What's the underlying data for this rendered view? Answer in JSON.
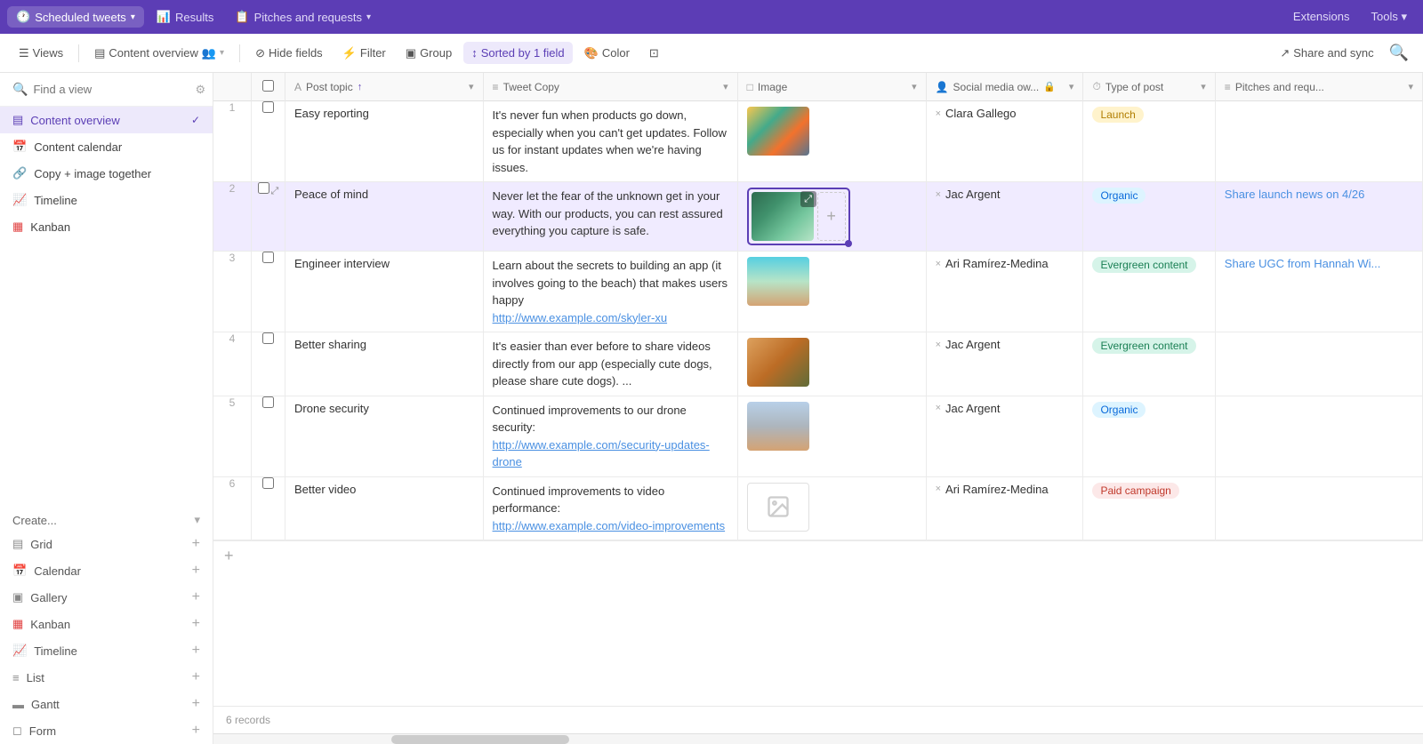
{
  "topbar": {
    "tabs": [
      {
        "id": "scheduled",
        "icon": "🕐",
        "label": "Scheduled tweets",
        "active": true,
        "hasChevron": true
      },
      {
        "id": "results",
        "icon": "📊",
        "label": "Results",
        "active": false,
        "hasChevron": false
      },
      {
        "id": "pitches",
        "icon": "📋",
        "label": "Pitches and requests",
        "active": false,
        "hasChevron": false
      }
    ],
    "right": [
      {
        "id": "extensions",
        "label": "Extensions"
      },
      {
        "id": "tools",
        "label": "Tools ▾"
      }
    ]
  },
  "toolbar": {
    "views_label": "Views",
    "content_overview_label": "Content overview",
    "hide_fields_label": "Hide fields",
    "filter_label": "Filter",
    "group_label": "Group",
    "sort_label": "Sorted by 1 field",
    "color_label": "Color",
    "extra_label": "",
    "share_label": "Share and sync"
  },
  "sidebar": {
    "search_placeholder": "Find a view",
    "nav_items": [
      {
        "id": "content-overview",
        "icon": "▤",
        "label": "Content overview",
        "active": true
      },
      {
        "id": "content-calendar",
        "icon": "📅",
        "label": "Content calendar",
        "active": false
      },
      {
        "id": "copy-image",
        "icon": "🔗",
        "label": "Copy + image together",
        "active": false
      },
      {
        "id": "timeline",
        "icon": "📈",
        "label": "Timeline",
        "active": false
      },
      {
        "id": "kanban",
        "icon": "▦",
        "label": "Kanban",
        "active": false
      }
    ],
    "create_label": "Create...",
    "create_items": [
      {
        "id": "grid",
        "icon": "▤",
        "label": "Grid"
      },
      {
        "id": "calendar",
        "icon": "📅",
        "label": "Calendar"
      },
      {
        "id": "gallery",
        "icon": "▣",
        "label": "Gallery"
      },
      {
        "id": "kanban2",
        "icon": "▦",
        "label": "Kanban"
      },
      {
        "id": "timeline2",
        "icon": "📈",
        "label": "Timeline"
      },
      {
        "id": "list",
        "icon": "≡",
        "label": "List"
      },
      {
        "id": "gantt",
        "icon": "▬",
        "label": "Gantt"
      },
      {
        "id": "form",
        "icon": "◻",
        "label": "Form"
      }
    ]
  },
  "table": {
    "columns": [
      {
        "id": "num",
        "label": ""
      },
      {
        "id": "checkbox",
        "label": ""
      },
      {
        "id": "topic",
        "label": "Post topic",
        "icon": "A"
      },
      {
        "id": "tweet",
        "label": "Tweet Copy",
        "icon": "≡"
      },
      {
        "id": "image",
        "label": "Image",
        "icon": "□"
      },
      {
        "id": "owner",
        "label": "Social media ow...",
        "icon": "👤"
      },
      {
        "id": "type",
        "label": "Type of post",
        "icon": "⏱"
      },
      {
        "id": "pitches",
        "label": "Pitches and requ...",
        "icon": "≡"
      }
    ],
    "rows": [
      {
        "num": "1",
        "topic": "Easy reporting",
        "tweet": "It's never fun when products go down, especially when you can't get updates. Follow us for instant updates when we're having issues.",
        "tweet_link": null,
        "image_type": "colorful",
        "owner": "Clara Gallego",
        "type": "Launch",
        "type_color": "launch",
        "pitches": ""
      },
      {
        "num": "2",
        "topic": "Peace of mind",
        "tweet": "Never let the fear of the unknown get in your way. With our products, you can rest assured everything you capture is safe.",
        "tweet_link": null,
        "image_type": "green",
        "image_active": true,
        "owner": "Jac Argent",
        "type": "Organic",
        "type_color": "organic",
        "pitches": "Share launch news on 4/26"
      },
      {
        "num": "3",
        "topic": "Engineer interview",
        "tweet": "Learn about the secrets to building an app (it involves going to the beach) that makes users happy",
        "tweet_link": "http://www.example.com/skyler-xu",
        "image_type": "beach",
        "owner": "Ari Ramírez-Medina",
        "type": "Evergreen content",
        "type_color": "evergreen",
        "pitches": "Share UGC from Hannah Wi..."
      },
      {
        "num": "4",
        "topic": "Better sharing",
        "tweet": "It's easier than ever before to share videos directly from our app (especially cute dogs, please share cute dogs). ...",
        "tweet_link": null,
        "image_type": "dog",
        "owner": "Jac Argent",
        "type": "Evergreen content",
        "type_color": "evergreen",
        "pitches": ""
      },
      {
        "num": "5",
        "topic": "Drone security",
        "tweet": "Continued improvements to our drone security:",
        "tweet_link": "http://www.example.com/security-updates-drone",
        "image_type": "drone",
        "owner": "Jac Argent",
        "type": "Organic",
        "type_color": "organic",
        "pitches": ""
      },
      {
        "num": "6",
        "topic": "Better video",
        "tweet": "Continued improvements to video performance:",
        "tweet_link": "http://www.example.com/video-improvements",
        "image_type": "placeholder",
        "owner": "Ari Ramírez-Medina",
        "type": "Paid campaign",
        "type_color": "paid",
        "pitches": ""
      }
    ],
    "records_count": "6 records"
  }
}
